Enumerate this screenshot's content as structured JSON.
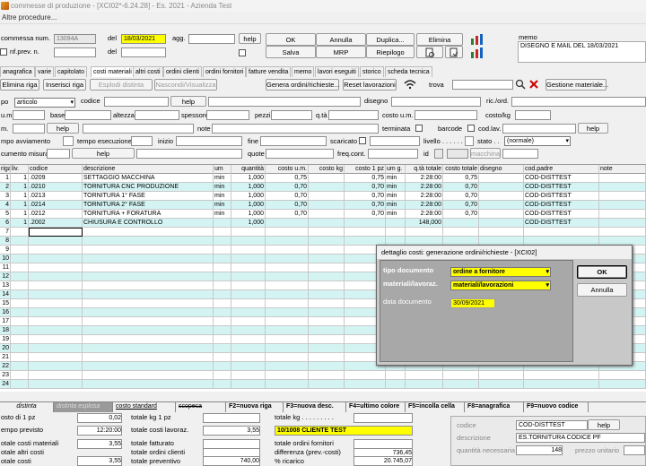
{
  "window": {
    "title": "commesse di produzione - [XCI02*-6.24.28] - Es. 2021 - Azienda Test"
  },
  "menu": {
    "label": "Altre procedure..."
  },
  "header": {
    "commessa_label": "commessa num.",
    "commessa_value": "13094A",
    "del_label": "del",
    "del_value": "18/03/2021",
    "agg_label": "agg.",
    "nf_prev_label": "nf.prev. n.",
    "del2_label": "del",
    "help_label": "help",
    "ok_label": "OK",
    "annulla_label": "Annulla",
    "duplica_label": "Duplica...",
    "elimina_label": "Elimina",
    "salva_label": "Salva",
    "mrp_label": "MRP",
    "riepilogo_label": "Riepilogo",
    "memo_label": "memo",
    "memo_value": "DISEGNO E MAIL DEL 18/03/2021"
  },
  "tabs": [
    "anagrafica",
    "varie",
    "capitolato",
    "costi materiali",
    "altri costi",
    "ordini clienti",
    "ordini fornitori",
    "fatture vendita",
    "memo",
    "lavori eseguiti",
    "storico",
    "scheda tecnica"
  ],
  "toolbar": {
    "elimina_riga": "Elimina riga",
    "inserisci_riga": "Inserisci riga",
    "esplodi_distinta": "Esplodi distinta",
    "nascondi": "Nascondi/Visualizza",
    "genera_ordini": "Genera ordini/richieste...",
    "reset_lavorazioni": "Reset lavorazioni",
    "trova_label": "trova",
    "gestione_materiale": "Gestione materiale..."
  },
  "form": {
    "tipo_label": "po",
    "tipo_value": "articolo",
    "codice_label": "codice",
    "help": "help",
    "disegno_label": "disegno",
    "ric_ord_label": "ric./ord.",
    "um_label": "u.m.",
    "base_label": "base",
    "altezza_label": "altezza",
    "spessore_label": "spessore",
    "pezzi_label": "pezzi",
    "qta_label": "q.tà",
    "costo_um_label": "costo u.m.",
    "costo_kg_label": "costo/kg",
    "m_label": "m.",
    "note_label": "note",
    "terminata_label": "terminata",
    "barcode_label": "barcode",
    "cod_lav_label": "cod.lav.",
    "tempo_avv_label": "mpo avviamento",
    "tempo_esec_label": "tempo esecuzione",
    "inizio_label": "inizio",
    "fine_label": "fine",
    "scaricato_label": "scaricato",
    "livello_label": "livello . . . . . .",
    "stato_label": "stato . .",
    "stato_value": "(normale)",
    "doc_misura_label": "cumento misura",
    "quote_label": "quote",
    "freq_cont_label": "freq.cont.",
    "id_label": "id",
    "macchina_label": "macchina"
  },
  "grid": {
    "columns": [
      "riga",
      "liv.",
      "codice",
      "descrizione",
      "um",
      "quantità",
      "costo u.m.",
      "costo kg",
      "costo 1 pz",
      "um g.",
      "q.tà totale",
      "costo totale",
      "disegno",
      "cod.padre",
      "note"
    ],
    "rows": [
      {
        "riga": "1",
        "liv": "1",
        "codice": ".0209",
        "descrizione": "SETTAGGIO MACCHINA",
        "um": "min",
        "quantita": "1,000",
        "costo_um": "0,75",
        "costo_kg": "",
        "costo_1pz": "0,75",
        "umg": "min",
        "qta_tot": "2:28:00",
        "costo_tot": "0,75",
        "disegno": "",
        "cod_padre": "COD-DISTTEST"
      },
      {
        "riga": "2",
        "liv": "1",
        "codice": ".0210",
        "descrizione": "TORNITURA CNC PRODUZIONE",
        "um": "min",
        "quantita": "1,000",
        "costo_um": "0,70",
        "costo_kg": "",
        "costo_1pz": "0,70",
        "umg": "min",
        "qta_tot": "2:28:00",
        "costo_tot": "0,70",
        "disegno": "",
        "cod_padre": "COD-DISTTEST"
      },
      {
        "riga": "3",
        "liv": "1",
        "codice": ".0213",
        "descrizione": "TORNITURA 1° FASE",
        "um": "min",
        "quantita": "1,000",
        "costo_um": "0,70",
        "costo_kg": "",
        "costo_1pz": "0,70",
        "umg": "min",
        "qta_tot": "2:28:00",
        "costo_tot": "0,70",
        "disegno": "",
        "cod_padre": "COD-DISTTEST"
      },
      {
        "riga": "4",
        "liv": "1",
        "codice": ".0214",
        "descrizione": "TORNITURA 2° FASE",
        "um": "min",
        "quantita": "1,000",
        "costo_um": "0,70",
        "costo_kg": "",
        "costo_1pz": "0,70",
        "umg": "min",
        "qta_tot": "2:28:00",
        "costo_tot": "0,70",
        "disegno": "",
        "cod_padre": "COD-DISTTEST"
      },
      {
        "riga": "5",
        "liv": "1",
        "codice": ".0212",
        "descrizione": "TORNITURA + FORATURA",
        "um": "min",
        "quantita": "1,000",
        "costo_um": "0,70",
        "costo_kg": "",
        "costo_1pz": "0,70",
        "umg": "min",
        "qta_tot": "2:28:00",
        "costo_tot": "0,70",
        "disegno": "",
        "cod_padre": "COD-DISTTEST"
      },
      {
        "riga": "6",
        "liv": "1",
        "codice": ".2002",
        "descrizione": "CHIUSURA E CONTROLLO",
        "um": "",
        "quantita": "1,000",
        "costo_um": "",
        "costo_kg": "",
        "costo_1pz": "",
        "umg": "",
        "qta_tot": "148,000",
        "costo_tot": "",
        "disegno": "",
        "cod_padre": "COD-DISTTEST"
      }
    ],
    "empty_rows": [
      "7",
      "8",
      "9",
      "10",
      "11",
      "12",
      "13",
      "14",
      "15",
      "16",
      "17",
      "18",
      "19",
      "20",
      "21",
      "22",
      "23",
      "24"
    ]
  },
  "footer_tabs": [
    "distinta",
    "distinta esplosa",
    "costo standard",
    "scopeca",
    "F2=nuova riga",
    "F3=nuova desc.",
    "F4=ultimo colore",
    "F5=incolla cella",
    "F8=anagrafica",
    "F9=nuovo codice"
  ],
  "summary": {
    "costo_1pz_label": "osto di 1 pz",
    "costo_1pz_value": "0,02",
    "totale_kg_label": "totale kg 1 pz",
    "totale_kg2_label": "totale kg . . . . . . . . .",
    "tempo_previsto_label": "empo previsto",
    "tempo_previsto_value": "12:20:00",
    "totale_costi_lav_label": "totale costi lavoraz.",
    "totale_costi_lav_value": "3,55",
    "cliente_value": "10/1008 CLIENTE TEST",
    "totale_mat_label": "otale costi materiali",
    "totale_mat_value": "3,55",
    "totale_fatturato_label": "totale fatturato",
    "totale_ordini_forn_label": "totale ordini fornitori",
    "altri_costi_label": "otale altri costi",
    "totale_ordini_cli_label": "totale ordini clienti",
    "differenza_label": "differenza (prev.-costi)",
    "differenza_value": "736,45",
    "totale_costi_label": "otale costi",
    "totale_costi_value": "3,55",
    "totale_preventivo_label": "totale preventivo",
    "totale_preventivo_value": "740,00",
    "ricarico_label": "% ricarico",
    "ricarico_value": "20.745,07"
  },
  "bottom_panel": {
    "codice_label": "codice",
    "codice_value": "COD-DISTTEST",
    "help": "help",
    "descrizione_label": "descrizione",
    "descrizione_value": "ES.TORNITURA CODICE PF",
    "qta_label": "quantità necessaria",
    "qta_value": "148",
    "prezzo_label": "prezzo unitario"
  },
  "dialog": {
    "title": "dettaglio costi: generazione ordini/richieste - [XCI02]",
    "tipo_doc_label": "tipo documento",
    "tipo_doc_value": "ordine a fornitore",
    "materiali_label": "materiali/lavoraz.",
    "materiali_value": "materiali/lavorazioni",
    "data_label": "data documento",
    "data_value": "30/09/2021",
    "ok_label": "OK",
    "annulla_label": "Annulla"
  }
}
